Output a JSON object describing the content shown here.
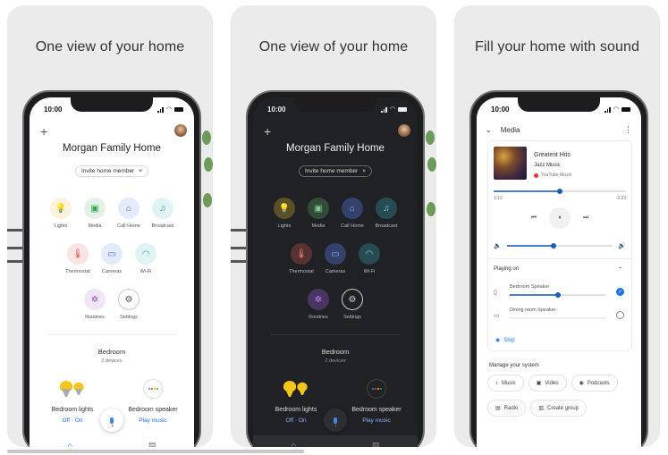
{
  "screens": [
    {
      "headline": "One view of your home",
      "theme": "light",
      "status": {
        "time": "10:00"
      },
      "home_title": "Morgan Family Home",
      "invite_chip": {
        "label": "Invite home member",
        "close": "×"
      },
      "tiles_row1": [
        {
          "label": "Lights",
          "icon": "💡",
          "bg": "#fdf3d8",
          "fg": "#e8a700"
        },
        {
          "label": "Media",
          "icon": "▣",
          "bg": "#e3f1e6",
          "fg": "#34a853"
        },
        {
          "label": "Call Home",
          "icon": "⌂",
          "bg": "#e4ebfb",
          "fg": "#4a6fc4"
        },
        {
          "label": "Broadcast",
          "icon": "♫",
          "bg": "#e0f3f5",
          "fg": "#3a9ba8"
        }
      ],
      "tiles_row2": [
        {
          "label": "Thermostat",
          "icon": "🌡",
          "bg": "#fbe4e3",
          "fg": "#d64a3f"
        },
        {
          "label": "Cameras",
          "icon": "▭",
          "bg": "#e4ebfb",
          "fg": "#4a6fc4"
        },
        {
          "label": "Wi-Fi",
          "icon": "◠",
          "bg": "#e0f3f5",
          "fg": "#3a9ba8"
        }
      ],
      "tiles_row3": [
        {
          "label": "Routines",
          "icon": "✲",
          "bg": "#f1e6f8",
          "fg": "#9a4ec0"
        },
        {
          "label": "Settings",
          "icon": "⚙",
          "bg": "#ffffff",
          "fg": "#555555"
        }
      ],
      "room": {
        "name": "Bedroom",
        "sub": "2 devices"
      },
      "devices": [
        {
          "name": "Bedroom lights",
          "action": "Off  ·  On"
        },
        {
          "name": "Bedroom speaker",
          "action": "Play music"
        }
      ],
      "nav": {
        "home_icon": "⌂",
        "feed_icon": "▤"
      }
    },
    {
      "headline": "One view of your home",
      "theme": "dark",
      "status": {
        "time": "10:00"
      },
      "home_title": "Morgan Family Home",
      "invite_chip": {
        "label": "Invite home member",
        "close": "×"
      },
      "tiles_row1": [
        {
          "label": "Lights",
          "icon": "💡",
          "bg": "#5b5025",
          "fg": "#f5c518"
        },
        {
          "label": "Media",
          "icon": "▣",
          "bg": "#2f4d38",
          "fg": "#81c995"
        },
        {
          "label": "Call Home",
          "icon": "⌂",
          "bg": "#34416a",
          "fg": "#8ab4f8"
        },
        {
          "label": "Broadcast",
          "icon": "♫",
          "bg": "#274b52",
          "fg": "#78d9ec"
        }
      ],
      "tiles_row2": [
        {
          "label": "Thermostat",
          "icon": "🌡",
          "bg": "#5a3131",
          "fg": "#f28b82"
        },
        {
          "label": "Cameras",
          "icon": "▭",
          "bg": "#34416a",
          "fg": "#8ab4f8"
        },
        {
          "label": "Wi-Fi",
          "icon": "◠",
          "bg": "#274b52",
          "fg": "#78d9ec"
        }
      ],
      "tiles_row3": [
        {
          "label": "Routines",
          "icon": "✲",
          "bg": "#4a3462",
          "fg": "#c58af9"
        },
        {
          "label": "Settings",
          "icon": "⚙",
          "bg": "#202124",
          "fg": "#cccccc"
        }
      ],
      "room": {
        "name": "Bedroom",
        "sub": "2 devices"
      },
      "devices": [
        {
          "name": "Bedroom lights",
          "action": "Off  ·  On"
        },
        {
          "name": "Bedroom speaker",
          "action": "Play music"
        }
      ],
      "nav": {
        "home_icon": "⌂",
        "feed_icon": "▤"
      }
    },
    {
      "headline": "Fill your home with sound",
      "theme": "light",
      "status": {
        "time": "10:00"
      },
      "media": {
        "header": "Media",
        "song": "Greatest Hits",
        "artist": "Jazz Music",
        "source": "YouTube Music",
        "elapsed": "1:12",
        "remaining": "-3:23",
        "progress_percent": 50,
        "volume_percent": 44,
        "playing_on_label": "Playing on",
        "speakers": [
          {
            "name": "Bedroom Speaker",
            "volume_percent": 50,
            "selected": true
          },
          {
            "name": "Dining room Speaker",
            "volume_percent": 0,
            "selected": false
          }
        ],
        "stop_label": "Stop",
        "manage_label": "Manage your system",
        "pills_row1": [
          {
            "label": "Music",
            "icon": "♪"
          },
          {
            "label": "Video",
            "icon": "▣"
          },
          {
            "label": "Podcasts",
            "icon": "◉"
          }
        ],
        "pills_row2": [
          {
            "label": "Radio",
            "icon": "▤"
          },
          {
            "label": "Create group",
            "icon": "▥"
          }
        ]
      }
    }
  ],
  "accent": "#1a73e8"
}
